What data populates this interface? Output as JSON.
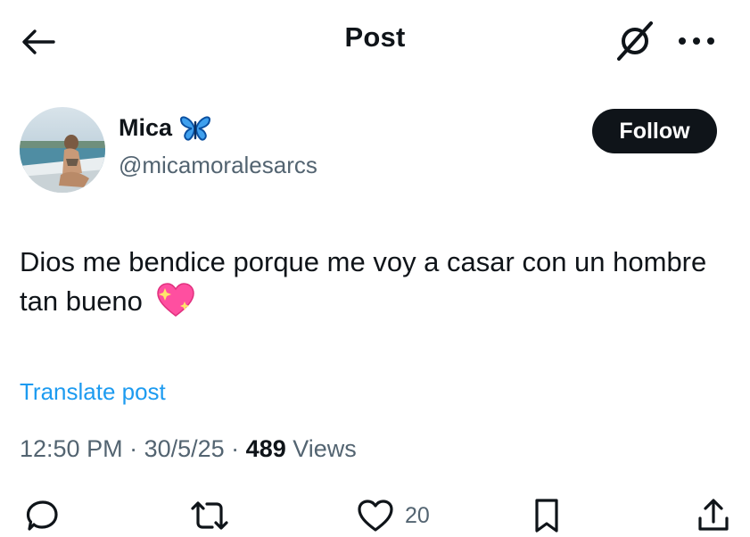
{
  "header": {
    "title": "Post",
    "back_icon": "arrow-left-icon",
    "grok_icon": "grok-icon",
    "more_icon": "more-horizontal-icon"
  },
  "author": {
    "display_name": "Mica",
    "badge_emoji": "butterfly-emoji",
    "handle": "@micamoralesarcs",
    "avatar": "avatar-photo"
  },
  "follow_label": "Follow",
  "post": {
    "text": "Dios me bendice porque me voy a casar con un hombre tan bueno",
    "emoji": "sparkling-heart-emoji"
  },
  "translate_label": "Translate post",
  "meta": {
    "time": "12:50 PM",
    "sep1": " · ",
    "date": "30/5/25",
    "sep2": " · ",
    "views_count": "489",
    "views_label": " Views"
  },
  "actions": {
    "reply_icon": "reply-icon",
    "repost_icon": "repost-icon",
    "like_icon": "heart-icon",
    "like_count": "20",
    "bookmark_icon": "bookmark-icon",
    "share_icon": "share-icon"
  },
  "colors": {
    "text": "#0f1419",
    "secondary": "#536471",
    "link": "#1d9bf0",
    "butterfly": "#1d7bd8",
    "heart_emoji": "#ff4fa0"
  }
}
